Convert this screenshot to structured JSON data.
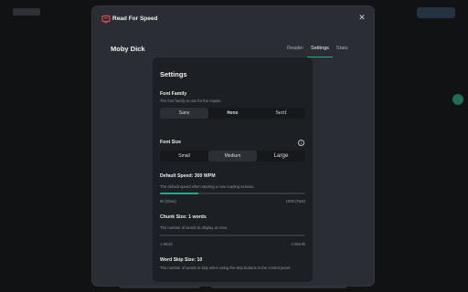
{
  "modal": {
    "title": "Read For Speed",
    "close_glyph": "✕"
  },
  "book": {
    "title": "Moby Dick"
  },
  "tabs": [
    {
      "label": "Reader",
      "active": false
    },
    {
      "label": "Settings",
      "active": true
    },
    {
      "label": "Stats",
      "active": false
    }
  ],
  "settings": {
    "title": "Settings",
    "font_family": {
      "label": "Font Family",
      "description": "The font family to use for the reader.",
      "options": [
        "Sans",
        "Mono",
        "Serif"
      ],
      "selected": "Sans"
    },
    "font_size": {
      "label": "Font Size",
      "options": [
        "Small",
        "Medium",
        "Large"
      ],
      "selected": "Medium"
    },
    "default_speed": {
      "label": "Default Speed: 300 WPM",
      "description": "The default speed when starting a new reading session.",
      "min_label": "50 (Slow)",
      "max_label": "1000 (Fast)",
      "value": 300,
      "min": 50,
      "max": 1000
    },
    "chunk_size": {
      "label": "Chunk Size: 1 words",
      "description": "The number of words to display at once.",
      "min_label": "1 Word",
      "max_label": "3 Words",
      "value": 1,
      "min": 1,
      "max": 3
    },
    "skip_size": {
      "label": "Word Skip Size: 10",
      "description": "The number of words to skip when using the skip buttons in the control panel."
    }
  },
  "colors": {
    "accent": "#27a88a",
    "danger_icon": "#d94b4b",
    "card_bg": "#1c1f23",
    "modal_bg": "#2a2d33"
  },
  "icons": {
    "app": "book-icon",
    "info": "info-icon",
    "close": "close-icon"
  }
}
